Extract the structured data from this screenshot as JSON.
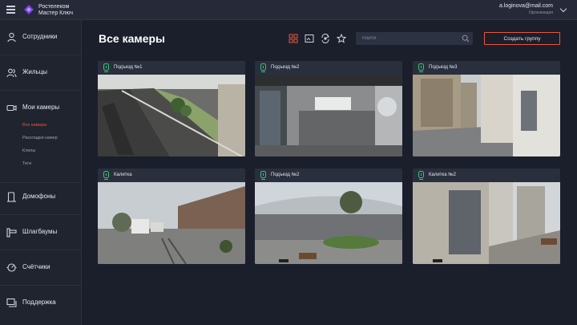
{
  "header": {
    "brand_line1": "Ростелеком",
    "brand_line2": "Мастер Ключ",
    "user_email": "a.loginova@mail.com",
    "user_org": "Организация",
    "logo_color": "#7b3fe4"
  },
  "sidebar": {
    "items": [
      {
        "label": "Сотрудники",
        "icon": "person-icon"
      },
      {
        "label": "Жильцы",
        "icon": "people-icon"
      },
      {
        "label": "Мои камеры",
        "icon": "camera-icon"
      },
      {
        "label": "Домофоны",
        "icon": "intercom-icon"
      },
      {
        "label": "Шлагбаумы",
        "icon": "barrier-icon"
      },
      {
        "label": "Счётчики",
        "icon": "meter-icon"
      },
      {
        "label": "Поддержка",
        "icon": "chat-icon"
      }
    ],
    "subitems": [
      {
        "label": "Все камеры",
        "active": true
      },
      {
        "label": "Раскладки камер",
        "active": false
      },
      {
        "label": "Клипы",
        "active": false
      },
      {
        "label": "Теги",
        "active": false
      }
    ]
  },
  "main": {
    "title": "Все камеры",
    "view_icons": [
      "grid-view-icon",
      "frame-view-icon",
      "rotate-icon",
      "star-icon"
    ],
    "search_placeholder": "Найти",
    "create_button": "Создать группу"
  },
  "cameras": [
    {
      "name": "Подъезд №1",
      "status_color": "#2ecc71"
    },
    {
      "name": "Подъезд №2",
      "status_color": "#2ecc71"
    },
    {
      "name": "Подъезд №3",
      "status_color": "#2ecc71"
    },
    {
      "name": "Калитка",
      "status_color": "#2ecc71"
    },
    {
      "name": "Подъезд №2",
      "status_color": "#2ecc71"
    },
    {
      "name": "Калитка №2",
      "status_color": "#2ecc71"
    }
  ],
  "colors": {
    "accent": "#e8553a",
    "background": "#1b1f2c",
    "sidebar": "#20242f",
    "card": "#2a2f3e"
  }
}
